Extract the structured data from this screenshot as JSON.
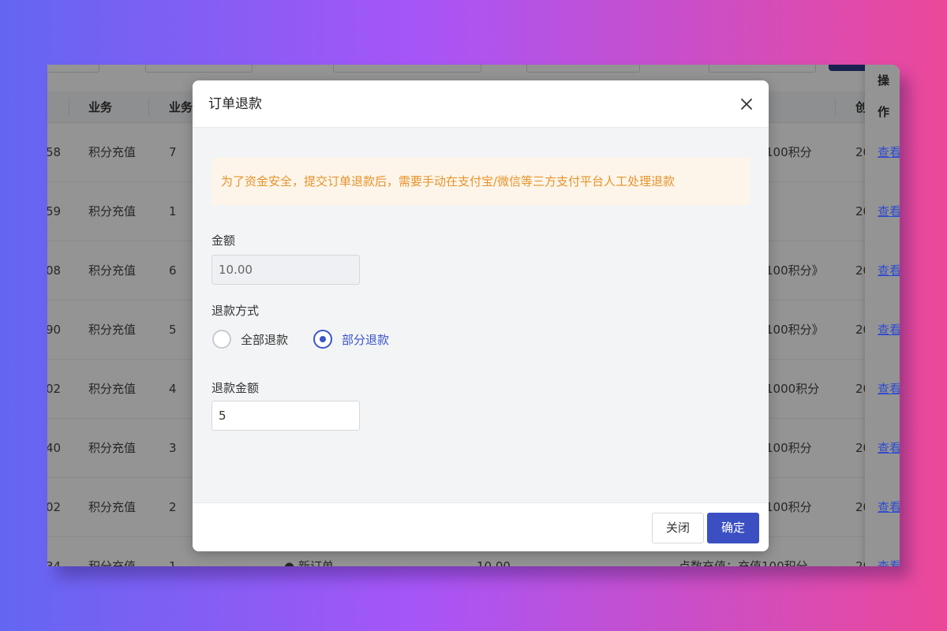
{
  "table": {
    "headers": [
      "业务",
      "业务",
      "创",
      "操作"
    ],
    "rows": [
      {
        "id_tail": "58",
        "business": "积分充值",
        "qty": "7",
        "desc": "100积分",
        "created": "20",
        "action": "查看"
      },
      {
        "id_tail": "59",
        "business": "积分充值",
        "qty": "1",
        "desc": "",
        "created": "20",
        "action": "查看"
      },
      {
        "id_tail": "08",
        "business": "积分充值",
        "qty": "6",
        "desc": "100积分》",
        "created": "20",
        "action": "查看"
      },
      {
        "id_tail": "90",
        "business": "积分充值",
        "qty": "5",
        "desc": "100积分》",
        "created": "20",
        "action": "查看"
      },
      {
        "id_tail": "02",
        "business": "积分充值",
        "qty": "4",
        "desc": "1000积分",
        "created": "20",
        "action": "查看"
      },
      {
        "id_tail": "40",
        "business": "积分充值",
        "qty": "3",
        "desc": "100积分",
        "created": "20",
        "action": "查看"
      },
      {
        "id_tail": "02",
        "business": "积分充值",
        "qty": "2",
        "desc": "100积分",
        "created": "20",
        "action": "查看"
      },
      {
        "id_tail": "34",
        "business": "积分充值",
        "qty": "1",
        "status": "● 新订单",
        "amount": "10.00",
        "desc": "点数充值：充值100积分",
        "created": "20",
        "action": "查看"
      }
    ]
  },
  "dialog": {
    "title": "订单退款",
    "notice": "为了资金安全，提交订单退款后，需要手动在支付宝/微信等三方支付平台人工处理退款",
    "amount_label": "金额",
    "amount_value": "10.00",
    "method_label": "退款方式",
    "method_options": [
      "全部退款",
      "部分退款"
    ],
    "method_selected": "部分退款",
    "refund_label": "退款金额",
    "refund_value": "5",
    "close_label": "关闭",
    "confirm_label": "确定"
  }
}
